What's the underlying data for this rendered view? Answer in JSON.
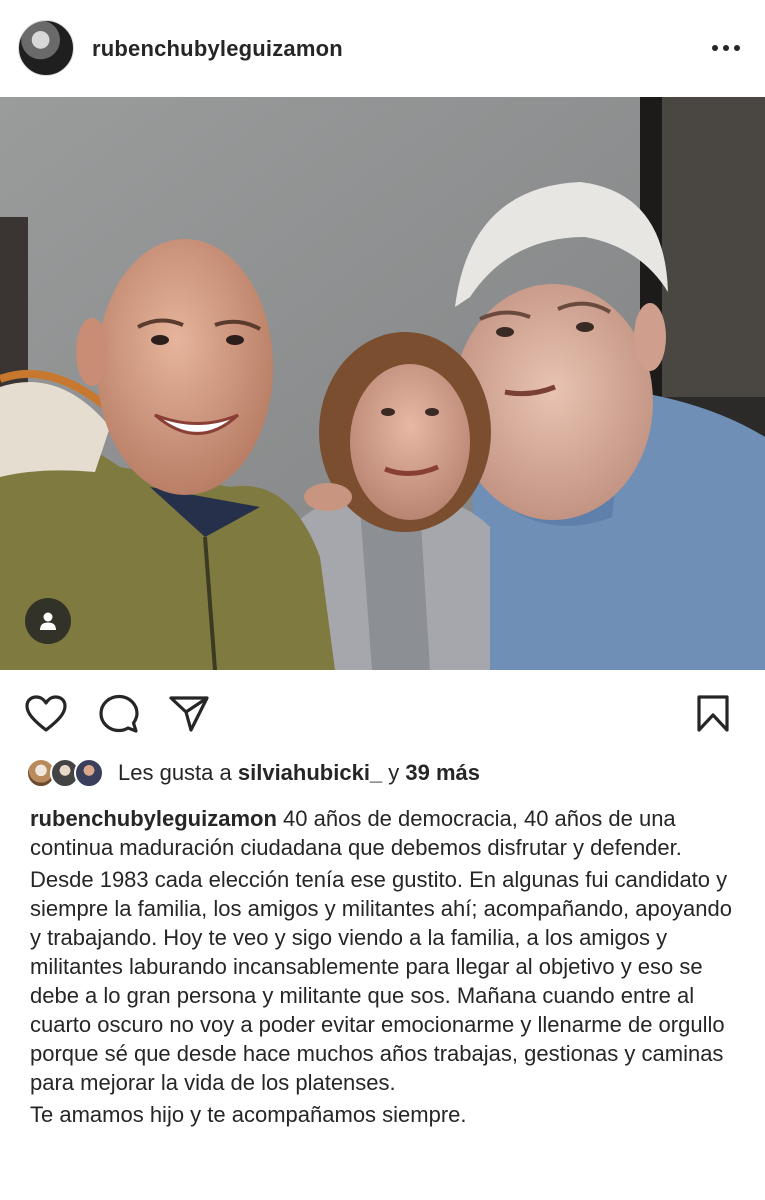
{
  "post": {
    "username": "rubenchubyleguizamon",
    "more_icon": "more-horizontal-icon"
  },
  "photo": {
    "alt": "",
    "tag_icon": "person-tag-icon"
  },
  "actions": {
    "like_icon": "heart-icon",
    "comment_icon": "comment-bubble-icon",
    "share_icon": "paper-plane-icon",
    "save_icon": "bookmark-icon"
  },
  "likes": {
    "prefix": "Les gusta a ",
    "user": "silviahubicki_",
    "connector": " y ",
    "count_text": "39 más"
  },
  "caption": {
    "username": "rubenchubyleguizamon",
    "paragraphs": [
      "40 años de democracia, 40 años de una continua maduración ciudadana que debemos disfrutar y defender.",
      "Desde 1983 cada elección tenía ese gustito. En algunas fui candidato y siempre la familia, los amigos y militantes ahí; acompañando, apoyando y trabajando. Hoy te veo y sigo viendo a la familia, a los amigos y militantes laburando incansablemente para llegar al objetivo y eso se debe a lo gran persona y militante que sos. Mañana cuando entre al cuarto oscuro no voy a poder evitar emocionarme y llenarme de orgullo porque sé que desde hace muchos años trabajas, gestionas y caminas para mejorar la vida de los platenses.",
      "Te amamos hijo y te acompañamos siempre."
    ]
  },
  "colors": {
    "text": "#262626",
    "background": "#ffffff"
  }
}
